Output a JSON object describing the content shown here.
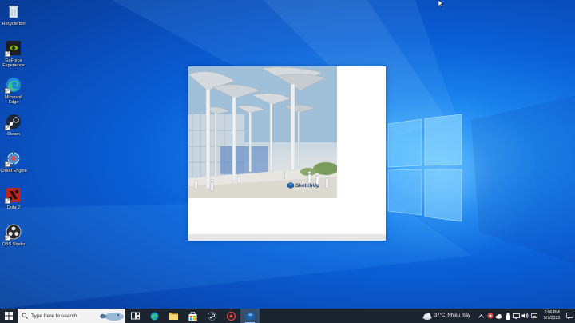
{
  "desktop": {
    "icons": [
      {
        "label": "Recycle Bin",
        "icon": "recycle-bin-icon"
      },
      {
        "label": "GeForce Experience",
        "icon": "geforce-icon"
      },
      {
        "label": "Microsoft Edge",
        "icon": "edge-icon"
      },
      {
        "label": "Steam",
        "icon": "steam-icon"
      },
      {
        "label": "Cheat Engine",
        "icon": "cheat-engine-icon"
      },
      {
        "label": "Dota 2",
        "icon": "dota2-icon"
      },
      {
        "label": "OBS Studio",
        "icon": "obs-icon"
      }
    ]
  },
  "splash": {
    "brand": "SketchUp",
    "image": "sketchup-architecture-rendering"
  },
  "taskbar": {
    "search_placeholder": "Type here to search",
    "apps": [
      "task-view-icon",
      "edge-icon",
      "file-explorer-icon",
      "store-icon",
      "steam-icon",
      "app-red-icon",
      "sketchup-icon"
    ],
    "weather": {
      "temp": "37°C",
      "condition": "Nhiều mây"
    },
    "clock": {
      "time": "2:06 PM",
      "date": "5/7/2023"
    }
  },
  "colors": {
    "desktop_blue": "#0a5fd6",
    "taskbar": "#1c2430",
    "accent": "#7fb8ff"
  }
}
